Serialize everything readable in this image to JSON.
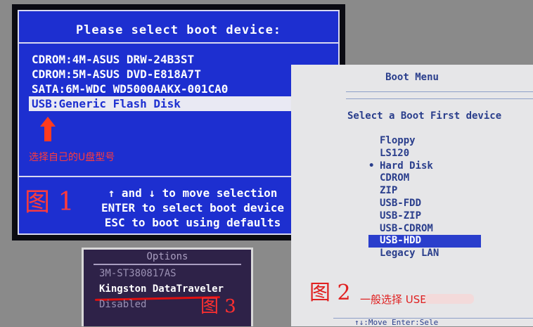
{
  "panel1": {
    "title": "Please select boot device:",
    "devices": [
      "CDROM:4M-ASUS DRW-24B3ST",
      "CDROM:5M-ASUS DVD-E818A7T",
      "SATA:6M-WDC WD5000AAKX-001CA0",
      "USB:Generic Flash Disk"
    ],
    "selected_index": 3,
    "note": "选择自己的U盘型号",
    "help": [
      "↑ and ↓ to move selection",
      "ENTER to select boot device",
      "ESC to boot using defaults"
    ],
    "label": "图 1",
    "colors": {
      "background": "#1d2fd0",
      "text": "#ffffff",
      "highlight": "#e9e9f3",
      "annotation": "#ff3b1f"
    }
  },
  "panel2": {
    "title": "Boot Menu",
    "prompt": "Select a Boot First device",
    "items": [
      "Floppy",
      "LS120",
      "Hard Disk",
      "CDROM",
      "ZIP",
      "USB-FDD",
      "USB-ZIP",
      "USB-CDROM",
      "USB-HDD",
      "Legacy LAN"
    ],
    "marked_item": "Hard Disk",
    "mark_symbol": "•",
    "selected_item": "USB-HDD",
    "label": "图 2",
    "label_note": "一般选择 USB-H",
    "footer": "↑↓:Move  Enter:Sele",
    "colors": {
      "background": "#e6e6e8",
      "text": "#2a3e8c",
      "highlight": "#2a3ecc"
    }
  },
  "panel3": {
    "title": "Options",
    "options": [
      "3M-ST380817AS",
      "Kingston DataTraveler",
      "Disabled"
    ],
    "selected_index": 1,
    "label": "图 3",
    "colors": {
      "background": "#2e2248",
      "underline": "#e01010"
    }
  }
}
